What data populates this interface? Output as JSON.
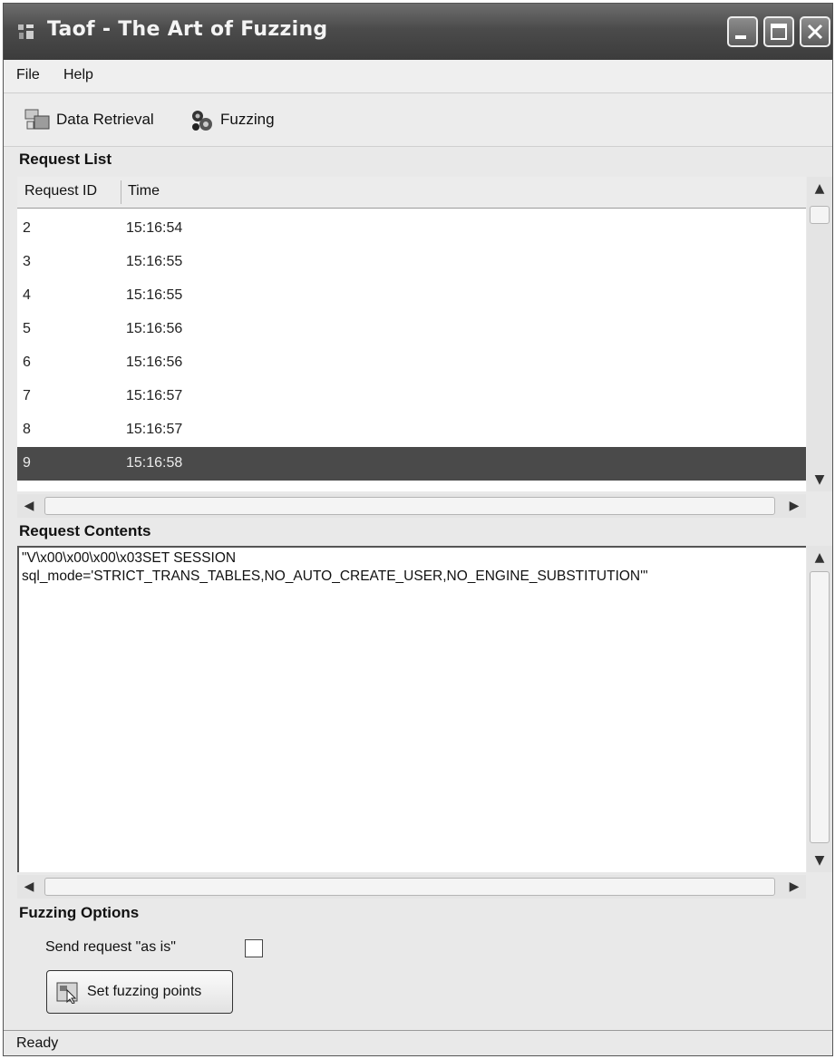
{
  "window": {
    "title": "Taof - The Art of Fuzzing"
  },
  "menu": {
    "items": [
      "File",
      "Help"
    ]
  },
  "toolbar": {
    "data_retrieval": "Data Retrieval",
    "fuzzing": "Fuzzing"
  },
  "request_list": {
    "heading": "Request List",
    "columns": [
      "Request ID",
      "Time"
    ],
    "rows": [
      {
        "id": "2",
        "time": "15:16:54"
      },
      {
        "id": "3",
        "time": "15:16:55"
      },
      {
        "id": "4",
        "time": "15:16:55"
      },
      {
        "id": "5",
        "time": "15:16:56"
      },
      {
        "id": "6",
        "time": "15:16:56"
      },
      {
        "id": "7",
        "time": "15:16:57"
      },
      {
        "id": "8",
        "time": "15:16:57"
      },
      {
        "id": "9",
        "time": "15:16:58"
      }
    ],
    "selected_id": "9"
  },
  "request_contents": {
    "heading": "Request Contents",
    "text": "\"V\\x00\\x00\\x00\\x03SET SESSION\nsql_mode='STRICT_TRANS_TABLES,NO_AUTO_CREATE_USER,NO_ENGINE_SUBSTITUTION'\""
  },
  "fuzzing_options": {
    "heading": "Fuzzing Options",
    "send_as_is_label": "Send request \"as is\"",
    "send_as_is_checked": false,
    "set_points_label": "Set fuzzing points"
  },
  "status": {
    "text": "Ready"
  },
  "colors": {
    "title_bar": "#4b4b4b",
    "selected_row": "#4a4a4a",
    "window_bg": "#e9e9e9"
  }
}
